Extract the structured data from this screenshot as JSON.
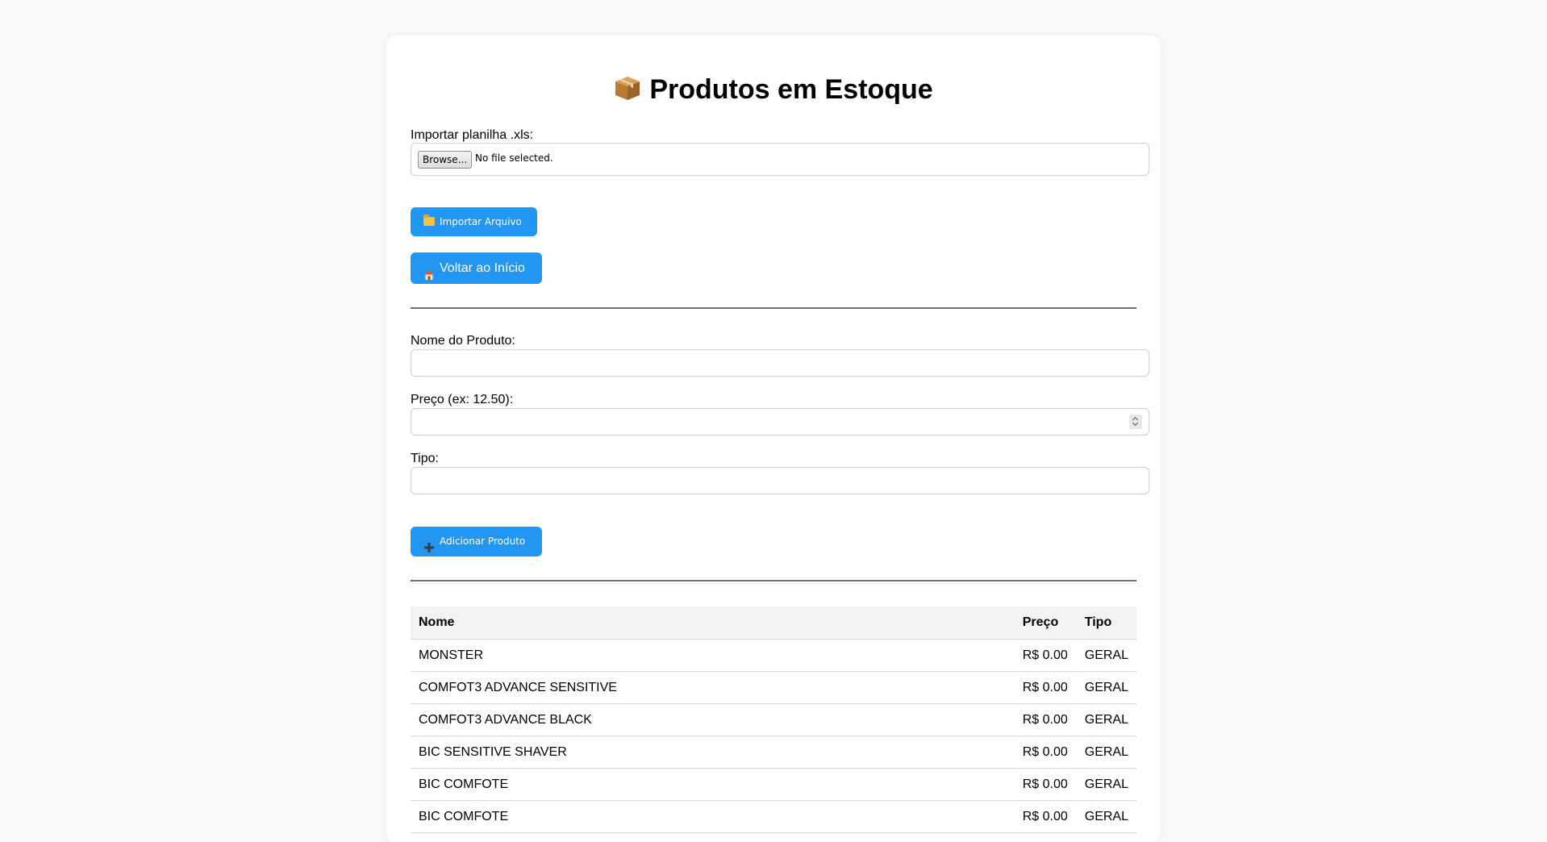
{
  "page": {
    "title": "Produtos em Estoque",
    "title_icon": "package-icon"
  },
  "import": {
    "label": "Importar planilha .xls:",
    "browse_label": "Browse...",
    "file_status": "No file selected.",
    "button_label": "Importar Arquivo",
    "button_icon": "folder-icon"
  },
  "home_button": {
    "label": "Voltar ao Início",
    "icon": "house-icon"
  },
  "form": {
    "name_label": "Nome do Produto:",
    "name_value": "",
    "price_label": "Preço (ex: 12.50):",
    "price_value": "",
    "type_label": "Tipo:",
    "type_value": "",
    "add_button_label": "Adicionar Produto",
    "add_button_icon": "plus-icon"
  },
  "table": {
    "headers": [
      "Nome",
      "Preço",
      "Tipo"
    ],
    "rows": [
      [
        "MONSTER",
        "R$ 0.00",
        "GERAL"
      ],
      [
        "COMFOT3 ADVANCE SENSITIVE",
        "R$ 0.00",
        "GERAL"
      ],
      [
        "COMFOT3 ADVANCE BLACK",
        "R$ 0.00",
        "GERAL"
      ],
      [
        "BIC SENSITIVE SHAVER",
        "R$ 0.00",
        "GERAL"
      ],
      [
        "BIC COMFOTE",
        "R$ 0.00",
        "GERAL"
      ],
      [
        "BIC COMFOTE",
        "R$ 0.00",
        "GERAL"
      ]
    ]
  },
  "colors": {
    "accent": "#2196f3",
    "background": "#f9f9f9",
    "card": "#ffffff",
    "table_header": "#f2f2f2"
  }
}
